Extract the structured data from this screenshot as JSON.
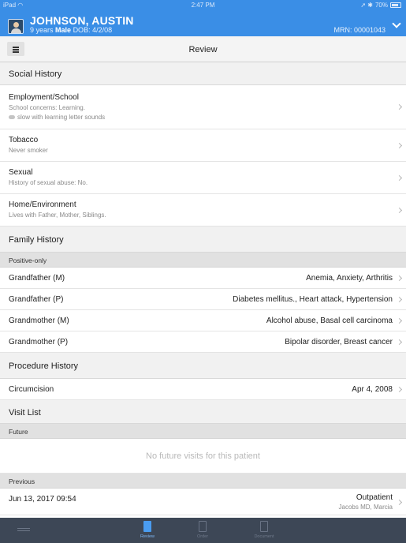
{
  "status_bar": {
    "device": "iPad",
    "time": "2:47 PM",
    "battery": "70%"
  },
  "patient": {
    "name": "JOHNSON, AUSTIN",
    "age": "9 years",
    "sex": "Male",
    "dob_label": "DOB:",
    "dob": "4/2/08",
    "mrn": "MRN: 00001043"
  },
  "navbar": {
    "title": "Review"
  },
  "social_history": {
    "title": "Social History",
    "rows": [
      {
        "title": "Employment/School",
        "detail": "School concerns: Learning.",
        "comment": "slow with learning letter sounds"
      },
      {
        "title": "Tobacco",
        "detail": "Never smoker"
      },
      {
        "title": "Sexual",
        "detail": "History of sexual abuse: No."
      },
      {
        "title": "Home/Environment",
        "detail": "Lives with Father, Mother, Siblings."
      }
    ]
  },
  "family_history": {
    "title": "Family History",
    "filter": "Positive-only",
    "rows": [
      {
        "relative": "Grandfather (M)",
        "conditions": "Anemia, Anxiety, Arthritis"
      },
      {
        "relative": "Grandfather (P)",
        "conditions": "Diabetes mellitus., Heart attack, Hypertension"
      },
      {
        "relative": "Grandmother (M)",
        "conditions": "Alcohol abuse, Basal cell carcinoma"
      },
      {
        "relative": "Grandmother (P)",
        "conditions": "Bipolar disorder, Breast cancer"
      }
    ]
  },
  "procedure_history": {
    "title": "Procedure History",
    "rows": [
      {
        "name": "Circumcision",
        "date": "Apr 4, 2008"
      }
    ]
  },
  "visit_list": {
    "title": "Visit List",
    "future_label": "Future",
    "future_empty": "No future visits for this patient",
    "previous_label": "Previous",
    "previous": [
      {
        "date": "Jun 13, 2017 09:54",
        "type": "Outpatient",
        "provider": "Jacobs MD, Marcia"
      }
    ]
  },
  "tabbar": {
    "tabs": [
      "Review",
      "Order",
      "Document"
    ],
    "active": "Review"
  },
  "colors": {
    "header": "#3a8ee6",
    "tabbar": "#3d4756",
    "active_tab": "#4a9cf0"
  }
}
